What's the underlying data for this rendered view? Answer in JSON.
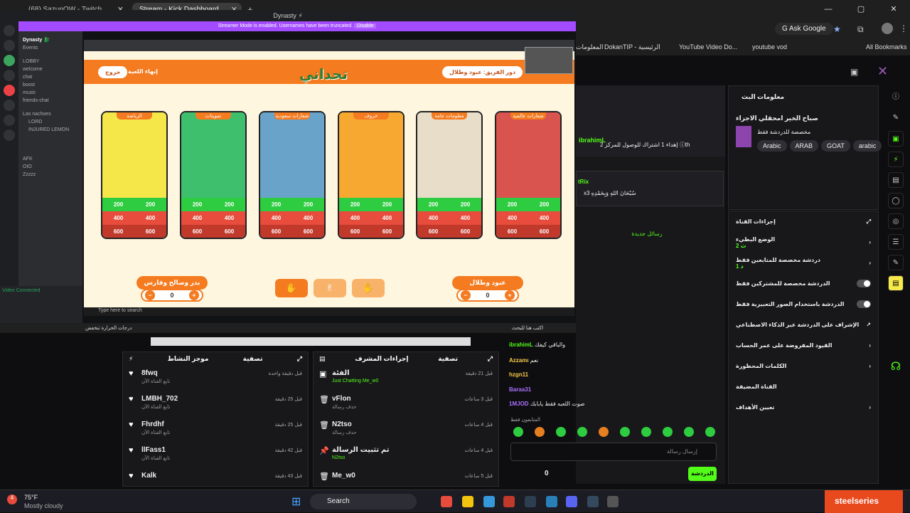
{
  "browser": {
    "tabs": [
      {
        "label": "(68) SazunOW - Twitch"
      },
      {
        "label": "Stream - Kick Dashboard"
      }
    ],
    "plus": "+",
    "win_min": "—",
    "win_max": "▢",
    "win_close": "✕"
  },
  "toolbar": {
    "ask_google": "Ask Google",
    "bookmarks": [
      "DokanTIP - الرئيسية",
      "YouTube Video Do...",
      "youtube vod",
      "All Bookmarks"
    ],
    "bm0": "المعلومات"
  },
  "discord": {
    "title": "Dynasty ⚡",
    "server_name": "Dynasty 🐉",
    "channels": [
      "Events",
      "LOBBY",
      "welcome",
      "chat",
      "boost",
      "music",
      "friends-chat",
      "Las nachoes",
      "AFK",
      "OIO",
      "Zzzzz"
    ],
    "voice_status": "Video Connected",
    "voice_users": [
      "LORD",
      "INJURED LEMON"
    ]
  },
  "banner": {
    "text": "Streamer Mode is enabled. Usernames have been truncated.",
    "disable": "Disable"
  },
  "game": {
    "exit": "خروج",
    "end": "إنهاء اللعبة",
    "title": "تحداني",
    "team_turn": "دور الفريق: عبود وطلال",
    "cards": [
      {
        "title": "الرياضة",
        "rows": [
          [
            "200",
            "200"
          ],
          [
            "400",
            "400"
          ],
          [
            "600",
            "600"
          ]
        ]
      },
      {
        "title": "تموينات",
        "rows": [
          [
            "200",
            "200"
          ],
          [
            "400",
            "400"
          ],
          [
            "600",
            "600"
          ]
        ]
      },
      {
        "title": "شعارات سعودية",
        "rows": [
          [
            "200",
            "200"
          ],
          [
            "400",
            "400"
          ],
          [
            "600",
            "600"
          ]
        ]
      },
      {
        "title": "حروف",
        "rows": [
          [
            "200",
            "200"
          ],
          [
            "400",
            "400"
          ],
          [
            "600",
            "600"
          ]
        ]
      },
      {
        "title": "معلومات عامة",
        "rows": [
          [
            "200",
            "200"
          ],
          [
            "400",
            "400"
          ],
          [
            "600",
            "600"
          ]
        ]
      },
      {
        "title": "شعارات عالمية",
        "rows": [
          [
            "200",
            "200"
          ],
          [
            "400",
            "400"
          ],
          [
            "600",
            "600"
          ]
        ]
      }
    ],
    "team_left": {
      "name": "بدر وصالح وفارس",
      "score": "0"
    },
    "team_right": {
      "name": "عبود وطلال",
      "score": "0"
    },
    "minus": "−",
    "plus": "+"
  },
  "activity": {
    "title": "موجز النشاط",
    "filter": "تصفية",
    "items": [
      {
        "name": "8fwq",
        "sub": "تابع القناة الآن",
        "time": "قبل دقيقة واحدة"
      },
      {
        "name": "LMBH_702",
        "sub": "تابع القناة الآن",
        "time": "قبل 25 دقيقة"
      },
      {
        "name": "Fhrdhf",
        "sub": "تابع القناة الآن",
        "time": "قبل 25 دقيقة"
      },
      {
        "name": "llFass1",
        "sub": "تابع القناة الآن",
        "time": "قبل 42 دقيقة"
      },
      {
        "name": "Kalk",
        "sub": "",
        "time": "قبل 43 دقيقة"
      }
    ]
  },
  "modlog": {
    "title": "إجراءات المشرف",
    "filter": "تصفية",
    "items": [
      {
        "name": "الفئة",
        "sub": "Just Chatting",
        "sub2": "Me_w0",
        "time": "قبل 21 دقيقة"
      },
      {
        "name": "vFlon",
        "sub": "حذف رسالة",
        "time": "قبل 3 ساعات"
      },
      {
        "name": "N2tso",
        "sub": "حذف رسالة",
        "time": "قبل 4 ساعات"
      },
      {
        "name": "تم تثبيت الرسالة",
        "sub": "N2tso",
        "time": "قبل 4 ساعات"
      },
      {
        "name": "Me_w0",
        "sub": "",
        "time": "قبل 5 ساعات"
      }
    ]
  },
  "chat": {
    "pinned_user": "ibrahimL",
    "pinned_text": "إهداء 1 اشتراك للوصول للمركز 2 ⓘth",
    "user2": "tRix",
    "text2": "x3 سُبْحَانَ اللهِ وَبِحَمْدِهِ",
    "notice": "رسائل جديدة",
    "lines": [
      {
        "nick": "ibrahimL",
        "text": "والباقي كيفك"
      },
      {
        "nick": "Azzamı",
        "text": "نعم"
      },
      {
        "nick": "hzgn11",
        "text": ""
      },
      {
        "nick": "Baraa31",
        "text": ""
      },
      {
        "nick": "1MJOD",
        "text": "صوت اللعبه فقط يابابك"
      }
    ],
    "followers_only": "المتابعون فقط",
    "placeholder": "إرسال رسالة",
    "send": "الدردشة",
    "count": "0"
  },
  "info": {
    "title": "معلومات البث",
    "stream_title": "صباح الخير امحقلي الاجزاء",
    "category": "مخصصة للدردشة فقط",
    "tags": [
      "Arabic",
      "ARAB",
      "GOAT",
      "arabic"
    ]
  },
  "settings": {
    "title": "إجراءات القناة",
    "rows": [
      {
        "label": "الوضع البطيء",
        "sub": "2 ث"
      },
      {
        "label": "دردشة مخصصة للمتابعين فقط",
        "sub": "1 د"
      },
      {
        "label": "الدردشة مخصصة للمشتركين فقط",
        "sub": ""
      },
      {
        "label": "الدردشة باستخدام الصور التعبيرية فقط",
        "sub": ""
      },
      {
        "label": "الإشراف على الدردشة عبر الذكاء الاصطناعي",
        "sub": ""
      },
      {
        "label": "القيود المفروضة على عمر الحساب",
        "sub": ""
      },
      {
        "label": "الكلمات المحظورة",
        "sub": ""
      },
      {
        "label": "القناة المضيفة",
        "sub": ""
      },
      {
        "label": "تعيين الأهداف",
        "sub": ""
      }
    ]
  },
  "weather": {
    "temp": "75°F",
    "cond": "Mostly cloudy"
  },
  "taskbar": {
    "search": "Search",
    "brand": "steelseries",
    "notif": "4"
  },
  "nested": {
    "search": "Type here to search",
    "search2": "اكتب هنا للبحث",
    "alert": "درجات الحرارة تنخفض"
  }
}
